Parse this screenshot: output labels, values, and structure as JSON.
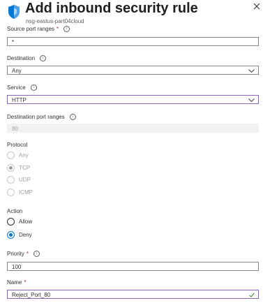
{
  "header": {
    "title": "Add inbound security rule",
    "subtitle": "nsg-eastus-part04cloud",
    "icon": "shield-icon",
    "close_icon": "close-icon"
  },
  "fields": {
    "source_port_ranges": {
      "label": "Source port ranges",
      "required": "*",
      "value": "*"
    },
    "destination": {
      "label": "Destination",
      "value": "Any"
    },
    "service": {
      "label": "Service",
      "value": "HTTP"
    },
    "destination_port_ranges": {
      "label": "Destination port ranges",
      "value": "80"
    },
    "priority": {
      "label": "Priority",
      "required": "*",
      "value": "100"
    },
    "name": {
      "label": "Name",
      "required": "*",
      "value": "Reject_Port_80"
    }
  },
  "protocol": {
    "label": "Protocol",
    "options": [
      "Any",
      "TCP",
      "UDP",
      "ICMP"
    ],
    "selected": "TCP",
    "disabled": true
  },
  "action": {
    "label": "Action",
    "options": [
      "Allow",
      "Deny"
    ],
    "selected": "Deny"
  },
  "colors": {
    "accent": "#0078d4",
    "focus_border": "#8764b8",
    "required": "#a4262c",
    "valid_check": "#107c10",
    "shield": "#0078d4"
  }
}
